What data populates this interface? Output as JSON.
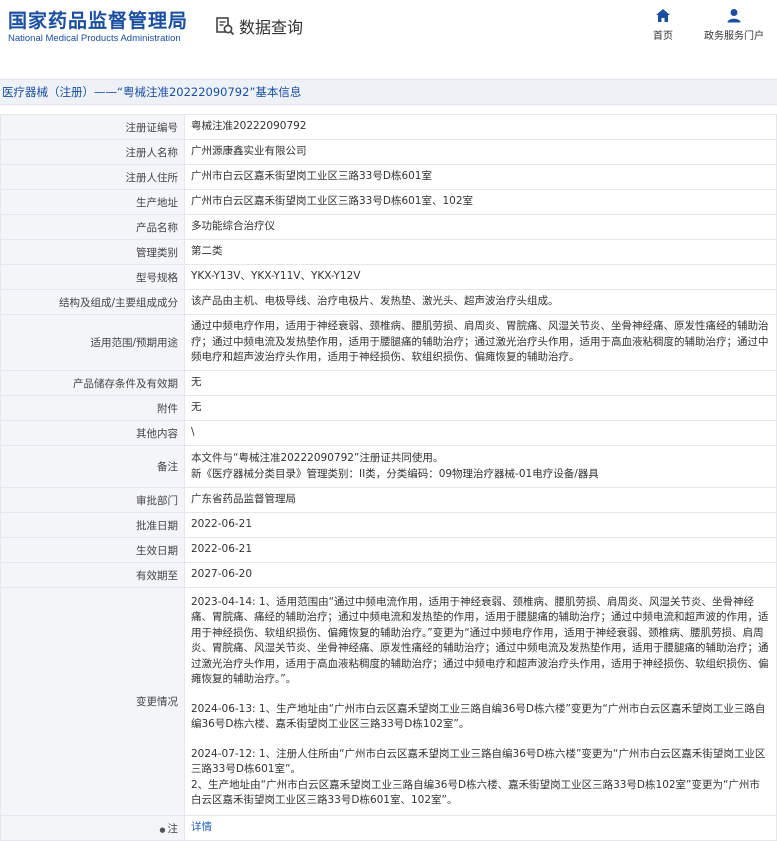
{
  "header": {
    "logo_cn": "国家药品监督管理局",
    "logo_en": "National Medical Products Administration",
    "search_title": "数据查询",
    "nav": [
      {
        "label": "首页",
        "icon": "home-icon"
      },
      {
        "label": "政务服务门户",
        "icon": "user-icon"
      }
    ]
  },
  "title_bar": "医疗器械（注册）——“粤械注准20222090792”基本信息",
  "rows": [
    {
      "label": "注册证编号",
      "value": [
        "粤械注准20222090792"
      ]
    },
    {
      "label": "注册人名称",
      "value": [
        "广州源康鑫实业有限公司"
      ]
    },
    {
      "label": "注册人住所",
      "value": [
        "广州市白云区嘉禾街望岗工业区三路33号D栋601室"
      ]
    },
    {
      "label": "生产地址",
      "value": [
        "广州市白云区嘉禾街望岗工业区三路33号D栋601室、102室"
      ]
    },
    {
      "label": "产品名称",
      "value": [
        "多功能综合治疗仪"
      ]
    },
    {
      "label": "管理类别",
      "value": [
        "第二类"
      ]
    },
    {
      "label": "型号规格",
      "value": [
        "YKX-Y13V、YKX-Y11V、YKX-Y12V"
      ]
    },
    {
      "label": "结构及组成/主要组成成分",
      "value": [
        "该产品由主机、电极导线、治疗电极片、发热垫、激光头、超声波治疗头组成。"
      ]
    },
    {
      "label": "适用范围/预期用途",
      "value": [
        "通过中频电疗作用，适用于神经衰弱、颈椎病、腰肌劳损、肩周炎、胃脘痛、风湿关节炎、坐骨神经痛、原发性痛经的辅助治疗；通过中频电流及发热垫作用，适用于腰腿痛的辅助治疗；通过激光治疗头作用，适用于高血液粘稠度的辅助治疗；通过中频电疗和超声波治疗头作用，适用于神经损伤、软组织损伤、偏瘫恢复的辅助治疗。"
      ]
    },
    {
      "label": "产品储存条件及有效期",
      "value": [
        "无"
      ]
    },
    {
      "label": "附件",
      "value": [
        "无"
      ]
    },
    {
      "label": "其他内容",
      "value": [
        "\\"
      ]
    },
    {
      "label": "备注",
      "value": [
        "本文件与“粤械注准20222090792”注册证共同使用。",
        "新《医疗器械分类目录》管理类别：II类，分类编码：09物理治疗器械-01电疗设备/器具"
      ]
    },
    {
      "label": "审批部门",
      "value": [
        "广东省药品监督管理局"
      ]
    },
    {
      "label": "批准日期",
      "value": [
        "2022-06-21"
      ]
    },
    {
      "label": "生效日期",
      "value": [
        "2022-06-21"
      ]
    },
    {
      "label": "有效期至",
      "value": [
        "2027-06-20"
      ]
    },
    {
      "label": "变更情况",
      "value": [
        "2023-04-14: 1、适用范围由“通过中频电流作用，适用于神经衰弱、颈椎病、腰肌劳损、肩周炎、风湿关节炎、坐骨神经痛、胃脘痛、痛经的辅助治疗；通过中频电流和发热垫的作用，适用于腰腿痛的辅助治疗；通过中频电流和超声波的作用，适用于神经损伤、软组织损伤、偏瘫恢复的辅助治疗。”变更为“通过中频电疗作用，适用于神经衰弱、颈椎病、腰肌劳损、肩周炎、胃脘痛、风湿关节炎、坐骨神经痛、原发性痛经的辅助治疗；通过中频电流及发热垫作用，适用于腰腿痛的辅助治疗；通过激光治疗头作用，适用于高血液粘稠度的辅助治疗；通过中频电疗和超声波治疗头作用，适用于神经损伤、软组织损伤、偏瘫恢复的辅助治疗。”。",
        "",
        "2024-06-13: 1、生产地址由“广州市白云区嘉禾望岗工业三路自编36号D栋六楼”变更为“广州市白云区嘉禾望岗工业三路自编36号D栋六楼、嘉禾街望岗工业区三路33号D栋102室”。",
        "",
        "2024-07-12: 1、注册人住所由“广州市白云区嘉禾望岗工业三路自编36号D栋六楼”变更为“广州市白云区嘉禾街望岗工业区三路33号D栋601室”。",
        "2、生产地址由“广州市白云区嘉禾望岗工业三路自编36号D栋六楼、嘉禾街望岗工业区三路33号D栋102室”变更为“广州市白云区嘉禾街望岗工业区三路33号D栋601室、102室”。"
      ]
    },
    {
      "label": "注",
      "value": [
        "详情"
      ],
      "label_icon": "info-dot-icon",
      "link": true
    }
  ]
}
